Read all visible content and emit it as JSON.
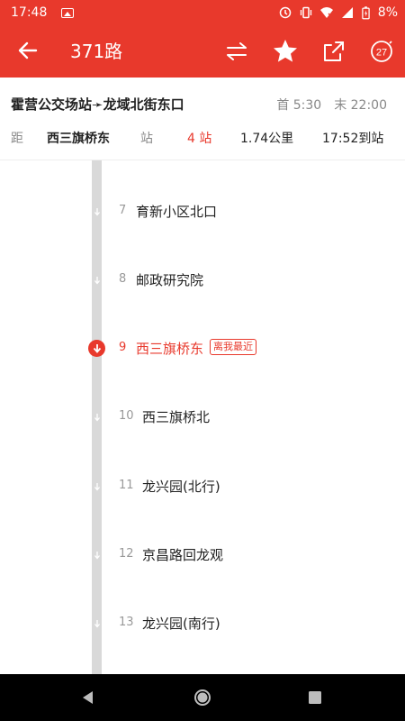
{
  "status_bar": {
    "time": "17:48",
    "battery": "8%"
  },
  "app_bar": {
    "title": "371路",
    "date_badge": "27"
  },
  "route": {
    "line_name": "霍营公交场站➛龙域北街东口",
    "first_bus": "首 5:30",
    "last_bus": "末 22:00",
    "distance_label": "距",
    "selected_stop": "西三旗桥东",
    "stop_label": "站",
    "stops_away": "4 站",
    "distance": "1.74公里",
    "arrival": "17:52到站"
  },
  "stops": [
    {
      "num": "7",
      "name": "育新小区北口"
    },
    {
      "num": "8",
      "name": "邮政研究院"
    },
    {
      "num": "9",
      "name": "西三旗桥东",
      "badge": "离我最近"
    },
    {
      "num": "10",
      "name": "西三旗桥北"
    },
    {
      "num": "11",
      "name": "龙兴园(北行)"
    },
    {
      "num": "12",
      "name": "京昌路回龙观"
    },
    {
      "num": "13",
      "name": "龙兴园(南行)"
    }
  ],
  "colors": {
    "accent": "#e8392c"
  }
}
